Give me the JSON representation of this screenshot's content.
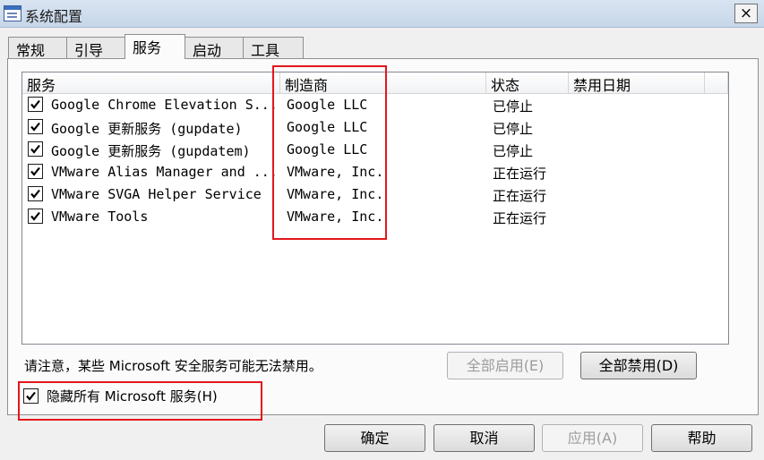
{
  "window": {
    "title": "系统配置",
    "close_label": "×"
  },
  "tabs": [
    {
      "label": "常规",
      "active": false
    },
    {
      "label": "引导",
      "active": false
    },
    {
      "label": "服务",
      "active": true
    },
    {
      "label": "启动",
      "active": false
    },
    {
      "label": "工具",
      "active": false
    }
  ],
  "table": {
    "columns": [
      "服务",
      "制造商",
      "状态",
      "禁用日期"
    ],
    "rows": [
      {
        "service": "Google Chrome Elevation S...",
        "manufacturer": "Google LLC",
        "status": "已停止",
        "date": "",
        "checked": true
      },
      {
        "service": "Google 更新服务 (gupdate)",
        "manufacturer": "Google LLC",
        "status": "已停止",
        "date": "",
        "checked": true
      },
      {
        "service": "Google 更新服务 (gupdatem)",
        "manufacturer": "Google LLC",
        "status": "已停止",
        "date": "",
        "checked": true
      },
      {
        "service": "VMware Alias Manager and ...",
        "manufacturer": "VMware, Inc.",
        "status": "正在运行",
        "date": "",
        "checked": true
      },
      {
        "service": "VMware SVGA Helper Service",
        "manufacturer": "VMware, Inc.",
        "status": "正在运行",
        "date": "",
        "checked": true
      },
      {
        "service": "VMware Tools",
        "manufacturer": "VMware, Inc.",
        "status": "正在运行",
        "date": "",
        "checked": true
      }
    ]
  },
  "note": "请注意，某些 Microsoft 安全服务可能无法禁用。",
  "enable_all_label": "全部启用(E)",
  "disable_all_label": "全部禁用(D)",
  "hide_ms": {
    "label": "隐藏所有 Microsoft 服务(H)",
    "checked": true
  },
  "footer": {
    "ok": "确定",
    "cancel": "取消",
    "apply": "应用(A)",
    "help": "帮助"
  },
  "icons": {
    "window": "msconfig-icon",
    "check": "checkmark-icon"
  },
  "colors": {
    "highlight_box": "#e3171b",
    "panel_bg": "#fbfbfb",
    "window_bg": "#f0f0f0"
  }
}
